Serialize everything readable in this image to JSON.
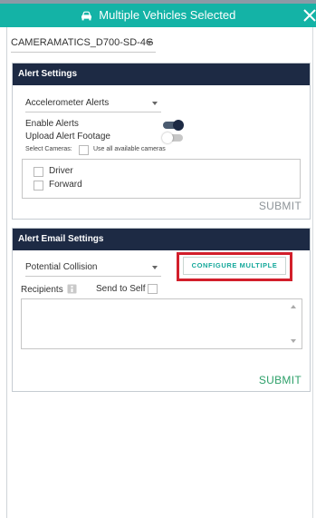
{
  "header": {
    "title": "Multiple Vehicles Selected",
    "icon": "car-icon",
    "close_icon": "close-icon",
    "color": "#14b3a6"
  },
  "vehicle": {
    "selected": "CAMERAMATICS_D700-SD-4G"
  },
  "alert_settings": {
    "title": "Alert Settings",
    "alert_type": "Accelerometer Alerts",
    "enable_alerts_label": "Enable Alerts",
    "enable_alerts_on": true,
    "upload_footage_label": "Upload Alert Footage",
    "upload_footage_on": false,
    "select_cameras_label": "Select Cameras:",
    "use_all_cameras_label": "Use all available cameras",
    "cameras": [
      "Driver",
      "Forward"
    ],
    "submit_label": "SUBMIT"
  },
  "email_settings": {
    "title": "Alert Email Settings",
    "alert_type": "Potential Collision",
    "configure_label": "CONFIGURE MULTIPLE",
    "recipients_label": "Recipients",
    "send_to_self_label": "Send to Self",
    "submit_label": "SUBMIT"
  },
  "colors": {
    "panel_header": "#1d2a44",
    "accent": "#14a89a",
    "highlight": "#d21f2b"
  }
}
